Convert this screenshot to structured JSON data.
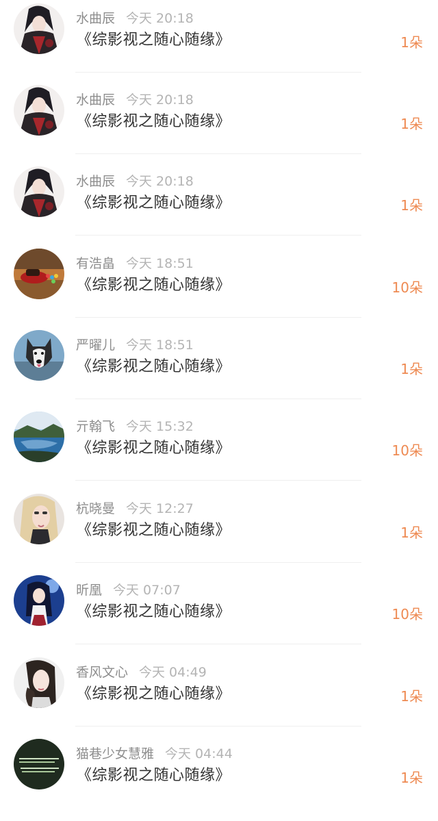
{
  "gifts": [
    {
      "name": "水曲辰",
      "time": "今天 20:18",
      "title": "《综影视之随心随缘》",
      "count": "1朵",
      "avatar": "anime-man-avatar"
    },
    {
      "name": "水曲辰",
      "time": "今天 20:18",
      "title": "《综影视之随心随缘》",
      "count": "1朵",
      "avatar": "anime-man-avatar"
    },
    {
      "name": "水曲辰",
      "time": "今天 20:18",
      "title": "《综影视之随心随缘》",
      "count": "1朵",
      "avatar": "anime-man-avatar"
    },
    {
      "name": "有浩畠",
      "time": "今天 18:51",
      "title": "《综影视之随心随缘》",
      "count": "10朵",
      "avatar": "toy-car-avatar"
    },
    {
      "name": "严曜儿",
      "time": "今天 18:51",
      "title": "《综影视之随心随缘》",
      "count": "1朵",
      "avatar": "husky-dog-avatar"
    },
    {
      "name": "亓翰飞",
      "time": "今天 15:32",
      "title": "《综影视之随心随缘》",
      "count": "10朵",
      "avatar": "lake-landscape-avatar"
    },
    {
      "name": "杭晓曼",
      "time": "今天 12:27",
      "title": "《综影视之随心随缘》",
      "count": "1朵",
      "avatar": "blonde-woman-avatar"
    },
    {
      "name": "昕凰",
      "time": "今天 07:07",
      "title": "《综影视之随心随缘》",
      "count": "10朵",
      "avatar": "anime-girl-avatar"
    },
    {
      "name": "香风文心",
      "time": "今天 04:49",
      "title": "《综影视之随心随缘》",
      "count": "1朵",
      "avatar": "woman-portrait-avatar"
    },
    {
      "name": "猫巷少女慧雅",
      "time": "今天 04:44",
      "title": "《综影视之随心随缘》",
      "count": "1朵",
      "avatar": "text-image-avatar"
    }
  ]
}
